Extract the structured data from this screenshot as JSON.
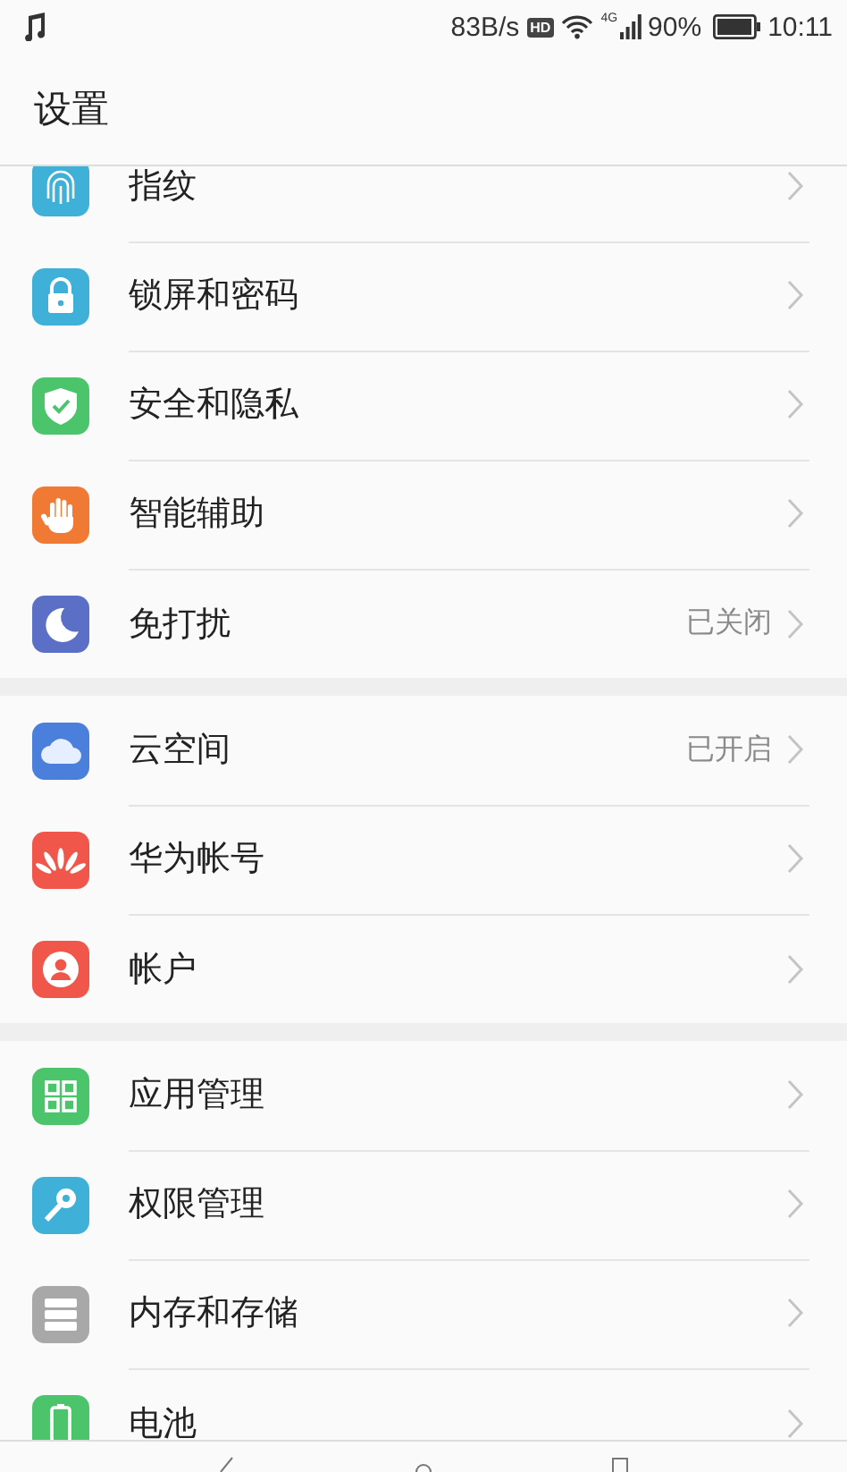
{
  "status_bar": {
    "speed": "83B/s",
    "hd_badge": "HD",
    "network": "4G",
    "battery": "90%",
    "time": "10:11"
  },
  "title": "设置",
  "groups": [
    {
      "items": [
        {
          "kind": "fingerprint",
          "color": "#3fb0d8",
          "label": "指纹"
        },
        {
          "kind": "lock",
          "color": "#3fb0d8",
          "label": "锁屏和密码"
        },
        {
          "kind": "shield",
          "color": "#4cc46c",
          "label": "安全和隐私"
        },
        {
          "kind": "hand",
          "color": "#f07a34",
          "label": "智能辅助"
        },
        {
          "kind": "moon",
          "color": "#5c6fc6",
          "label": "免打扰",
          "value": "已关闭"
        }
      ]
    },
    {
      "items": [
        {
          "kind": "cloud",
          "color": "#4a80dc",
          "label": "云空间",
          "value": "已开启"
        },
        {
          "kind": "petals",
          "color": "#f0564a",
          "label": "华为帐号"
        },
        {
          "kind": "person",
          "color": "#f0564a",
          "label": "帐户"
        }
      ]
    },
    {
      "items": [
        {
          "kind": "grid",
          "color": "#4cc46c",
          "label": "应用管理"
        },
        {
          "kind": "key",
          "color": "#3fb0d8",
          "label": "权限管理"
        },
        {
          "kind": "storage",
          "color": "#a8a8a8",
          "label": "内存和存储"
        },
        {
          "kind": "battery",
          "color": "#4cc46c",
          "label": "电池"
        }
      ]
    }
  ]
}
